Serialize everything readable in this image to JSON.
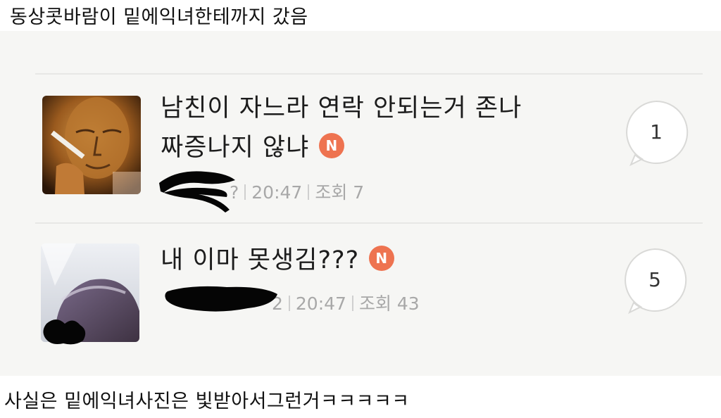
{
  "caption_top": "동상콧바람이 밑에익녀한테까지 갔음",
  "caption_bottom": "사실은 밑에익녀사진은 빛받아서그런거ㅋㅋㅋㅋㅋ",
  "posts": [
    {
      "title_line1": "남친이 자느라 연락 안되는거 존나",
      "title_line2": "짜증나지 않냐",
      "badge": "N",
      "author_tail": "?",
      "time": "20:47",
      "views": "조회 7",
      "comment_count": "1"
    },
    {
      "title_line1": "내 이마 못생김???",
      "badge": "N",
      "author_tail": "2",
      "time": "20:47",
      "views": "조회 43",
      "comment_count": "5"
    }
  ],
  "colors": {
    "badge": "#ee7350",
    "meta_text": "#a8a8a8",
    "panel_bg": "#f6f6f4"
  }
}
